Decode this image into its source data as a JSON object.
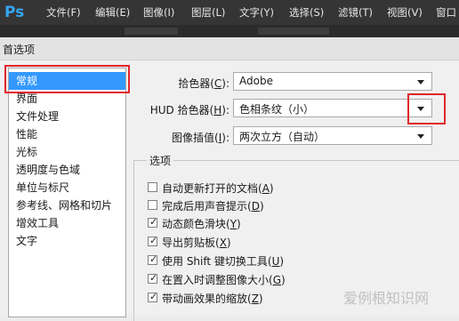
{
  "app": {
    "logo": "Ps"
  },
  "menu": [
    "文件(F)",
    "编辑(E)",
    "图像(I)",
    "图层(L)",
    "文字(Y)",
    "选择(S)",
    "滤镜(T)",
    "视图(V)",
    "窗口"
  ],
  "dialog": {
    "title": "首选项",
    "categories": [
      "常规",
      "界面",
      "文件处理",
      "性能",
      "光标",
      "透明度与色域",
      "单位与标尺",
      "参考线、网格和切片",
      "增效工具",
      "文字"
    ],
    "selected_category": "常规",
    "color_picker": {
      "label": "拾色器(",
      "key": "C",
      "label_end": "):",
      "value": "Adobe"
    },
    "hud_picker": {
      "label": "HUD 拾色器(",
      "key": "H",
      "label_end": "):",
      "value": "色相条纹（小）"
    },
    "interpolation": {
      "label": "图像插值(",
      "key": "I",
      "label_end": "):",
      "value": "两次立方（自动）"
    },
    "options_group": "选项",
    "options": [
      {
        "text": "自动更新打开的文档(",
        "key": "A",
        "end": ")",
        "checked": false
      },
      {
        "text": "完成后用声音提示(",
        "key": "D",
        "end": ")",
        "checked": false
      },
      {
        "text": "动态颜色滑块(",
        "key": "Y",
        "end": ")",
        "checked": true
      },
      {
        "text": "导出剪贴板(",
        "key": "X",
        "end": ")",
        "checked": true
      },
      {
        "text": "使用 Shift 键切换工具(",
        "key": "U",
        "end": ")",
        "checked": true
      },
      {
        "text": "在置入时调整图像大小(",
        "key": "G",
        "end": ")",
        "checked": true
      },
      {
        "text": "带动画效果的缩放(",
        "key": "Z",
        "end": ")",
        "checked": true
      }
    ]
  },
  "watermark": "爱例根知识网",
  "colors": {
    "selection": "#3399ff",
    "highlight": "#e0262b",
    "menubar": "#353535",
    "ps_blue": "#33a6f0"
  }
}
